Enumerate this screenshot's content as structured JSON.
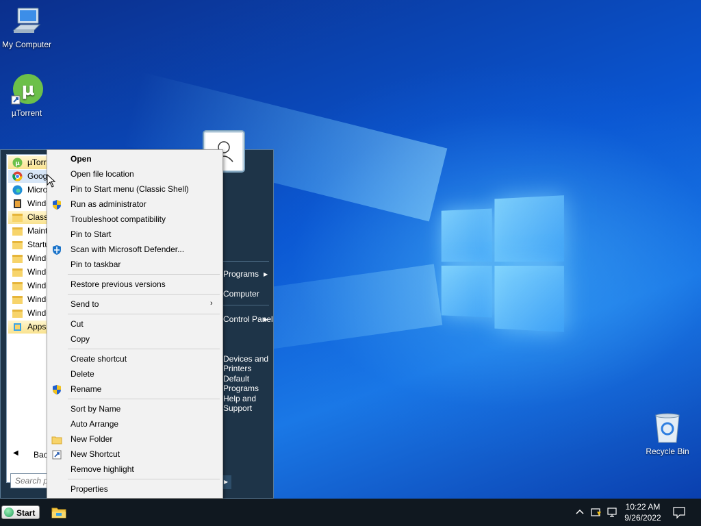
{
  "desktop": {
    "icons": [
      {
        "label": "My Computer"
      },
      {
        "label": "µTorrent"
      },
      {
        "label": "Recycle Bin"
      }
    ]
  },
  "start_menu": {
    "programs": [
      {
        "label": "µTorrent",
        "icon": "utorrent-icon"
      },
      {
        "label": "Google Chrome",
        "icon": "chrome-icon"
      },
      {
        "label": "Microsoft Edge",
        "icon": "edge-icon"
      },
      {
        "label": "Windows Media Player",
        "icon": "media-player-icon"
      },
      {
        "label": "Classic Shell",
        "icon": "folder-icon"
      },
      {
        "label": "Maintenance",
        "icon": "folder-icon"
      },
      {
        "label": "Startup",
        "icon": "folder-icon"
      },
      {
        "label": "Windows Accessories",
        "icon": "folder-icon"
      },
      {
        "label": "Windows Administrative Tools",
        "icon": "folder-icon"
      },
      {
        "label": "Windows Ease of Access",
        "icon": "folder-icon"
      },
      {
        "label": "Windows PowerShell",
        "icon": "folder-icon"
      },
      {
        "label": "Windows System",
        "icon": "folder-icon"
      },
      {
        "label": "Apps",
        "icon": "apps-icon"
      }
    ],
    "back_label": "Back",
    "search_placeholder": "Search programs and files",
    "right_items": [
      {
        "label": "Programs"
      },
      {
        "label": "Computer"
      },
      {
        "label": "Control Panel"
      },
      {
        "label": "Devices and Printers"
      },
      {
        "label": "Default Programs"
      },
      {
        "label": "Help and Support"
      }
    ]
  },
  "context_menu": {
    "groups": [
      [
        {
          "label": "Open",
          "bold": true
        },
        {
          "label": "Open file location"
        },
        {
          "label": "Pin to Start menu (Classic Shell)"
        },
        {
          "label": "Run as administrator",
          "icon": "uac-shield-icon"
        },
        {
          "label": "Troubleshoot compatibility"
        },
        {
          "label": "Pin to Start"
        },
        {
          "label": "Scan with Microsoft Defender...",
          "icon": "defender-icon"
        },
        {
          "label": "Pin to taskbar"
        }
      ],
      [
        {
          "label": "Restore previous versions"
        }
      ],
      [
        {
          "label": "Send to",
          "submenu": true
        }
      ],
      [
        {
          "label": "Cut"
        },
        {
          "label": "Copy"
        }
      ],
      [
        {
          "label": "Create shortcut"
        },
        {
          "label": "Delete"
        },
        {
          "label": "Rename",
          "icon": "uac-shield-icon"
        }
      ],
      [
        {
          "label": "Sort by Name"
        },
        {
          "label": "Auto Arrange"
        },
        {
          "label": "New Folder",
          "icon": "folder-icon"
        },
        {
          "label": "New Shortcut",
          "icon": "shortcut-icon"
        },
        {
          "label": "Remove highlight"
        }
      ],
      [
        {
          "label": "Properties"
        }
      ]
    ]
  },
  "taskbar": {
    "start_label": "Start",
    "time": "10:22 AM",
    "date": "9/26/2022"
  }
}
